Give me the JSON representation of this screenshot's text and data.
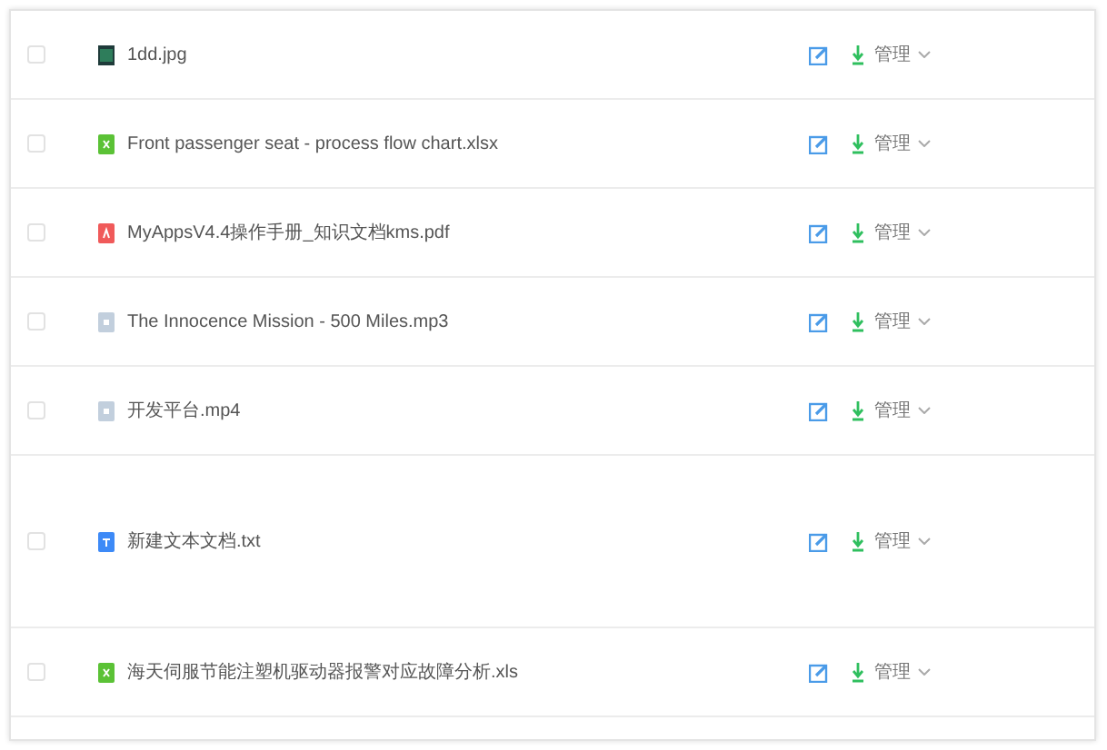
{
  "files": [
    {
      "name": "1dd.jpg",
      "kind": "image",
      "checked": false,
      "tall": false,
      "manage": "管理"
    },
    {
      "name": "Front passenger seat - process flow chart.xlsx",
      "kind": "excel",
      "checked": false,
      "tall": false,
      "manage": "管理"
    },
    {
      "name": "MyAppsV4.4操作手册_知识文档kms.pdf",
      "kind": "pdf",
      "checked": false,
      "tall": false,
      "manage": "管理"
    },
    {
      "name": "The Innocence Mission - 500 Miles.mp3",
      "kind": "generic",
      "checked": false,
      "tall": false,
      "manage": "管理"
    },
    {
      "name": "开发平台.mp4",
      "kind": "generic",
      "checked": false,
      "tall": false,
      "manage": "管理"
    },
    {
      "name": "新建文本文档.txt",
      "kind": "text",
      "checked": false,
      "tall": true,
      "manage": "管理"
    },
    {
      "name": "海天伺服节能注塑机驱动器报警对应故障分析.xls",
      "kind": "excel",
      "checked": false,
      "tall": false,
      "manage": "管理"
    }
  ]
}
